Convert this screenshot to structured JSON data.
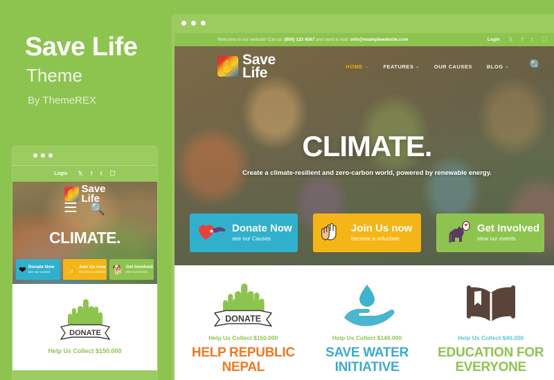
{
  "promo": {
    "title": "Save Life",
    "subtitle": "Theme",
    "author": "By ThemeREX"
  },
  "browser": {
    "dots_label": "window-controls"
  },
  "topbar": {
    "welcome_prefix": "Welcome to our website! Call us:",
    "phone": "(800) 123 4567",
    "welcome_mid": "and send e-mail:",
    "email": "info@examplewebsite.com",
    "login": "Login",
    "socials": [
      "twitter-icon",
      "facebook-icon",
      "tumblr-icon",
      "instagram-icon"
    ],
    "social_glyphs": [
      "𝕏",
      "f",
      "t",
      "□"
    ]
  },
  "logo": {
    "line1": "Save",
    "line2": "Life",
    "mark": "hand-logo-icon"
  },
  "nav": {
    "items": [
      {
        "label": "HOME",
        "caret": "⌄",
        "active": true
      },
      {
        "label": "FEATURES",
        "caret": "⌄",
        "active": false
      },
      {
        "label": "OUR CAUSES",
        "caret": "",
        "active": false
      },
      {
        "label": "BLOG",
        "caret": "⌄",
        "active": false
      }
    ],
    "search_icon": "🔍"
  },
  "hero": {
    "title": "CLIMATE.",
    "subtitle": "Create a climate-resilient and zero-carbon world, powered by renewable energy."
  },
  "cta": [
    {
      "icon": "heart-hand-icon",
      "glyph": "❤",
      "label": "Donate Now",
      "sub": "see our Causes",
      "color": "#31b0cd"
    },
    {
      "icon": "clapping-hands-icon",
      "glyph": "👏",
      "label": "Join Us now",
      "sub": "become a volunteer",
      "color": "#f5b516"
    },
    {
      "icon": "dog-icon",
      "glyph": "🐕",
      "label": "Get Involved",
      "sub": "view our events",
      "color": "#8dc450"
    }
  ],
  "causes": [
    {
      "icon": "hands-donate-ribbon-icon",
      "collect_label": "Help Us Collect",
      "amount": "$150.000",
      "title": "HELP REPUBLIC NEPAL",
      "color": "#f07822"
    },
    {
      "icon": "water-drop-hand-icon",
      "collect_label": "Help Us Collect",
      "amount": "$140.000",
      "title": "SAVE WATER INITIATIVE",
      "color": "#3fa9cd"
    },
    {
      "icon": "open-book-icon",
      "collect_label": "Help Us Collect",
      "amount": "$40.000",
      "title": "EDUCATION FOR EVERYONE",
      "color": "#8dc450"
    }
  ],
  "mobile": {
    "login": "Login",
    "logo_line1": "Save",
    "logo_line2": "Life",
    "hero_title": "CLIMATE.",
    "menu_icon": "hamburger-menu-icon",
    "search_icon": "🔍",
    "buttons": [
      {
        "glyph": "❤",
        "label": "Donate Now",
        "sub": "see our Causes"
      },
      {
        "glyph": "👏",
        "label": "Join Us now",
        "sub": "become a volunteer"
      },
      {
        "glyph": "🐕",
        "label": "Get Involved",
        "sub": "view our events"
      }
    ],
    "collect_label": "Help Us Collect",
    "collect_amount": "$150.000"
  },
  "colors": {
    "brand_green": "#8dc450",
    "accent_orange": "#f07822",
    "accent_blue": "#31b0cd",
    "accent_yellow": "#f5b516",
    "nav_active": "#f0a91e"
  }
}
